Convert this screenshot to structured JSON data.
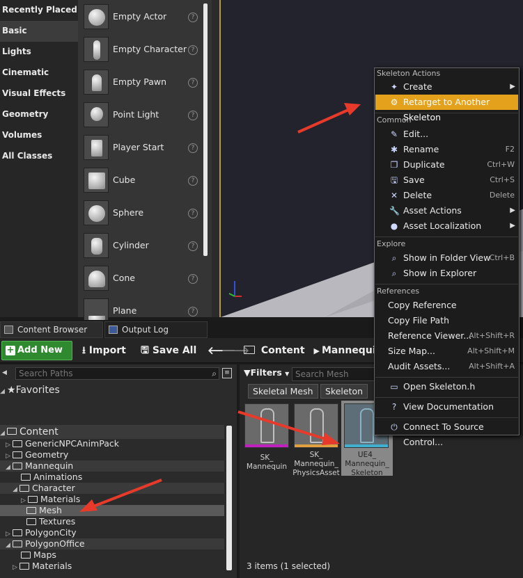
{
  "modes": {
    "categories": [
      "Recently Placed",
      "Basic",
      "Lights",
      "Cinematic",
      "Visual Effects",
      "Geometry",
      "Volumes",
      "All Classes"
    ],
    "selected_category": "Basic",
    "items": [
      "Empty Actor",
      "Empty Character",
      "Empty Pawn",
      "Point Light",
      "Player Start",
      "Cube",
      "Sphere",
      "Cylinder",
      "Cone",
      "Plane"
    ]
  },
  "tabs": {
    "content_browser": "Content Browser",
    "output_log": "Output Log"
  },
  "toolbar": {
    "add_new": "Add New",
    "import": "Import",
    "save_all": "Save All",
    "path_root": "Content",
    "path_child": "Mannequin"
  },
  "paths": {
    "search_placeholder": "Search Paths",
    "favorites": "Favorites",
    "tree": [
      "Content",
      "GenericNPCAnimPack",
      "Geometry",
      "Mannequin",
      "Animations",
      "Character",
      "Materials",
      "Mesh",
      "Textures",
      "PolygonCity",
      "PolygonOffice",
      "Maps",
      "Materials"
    ]
  },
  "assets": {
    "filters": "Filters",
    "search_placeholder": "Search Mesh",
    "chips": [
      "Skeletal Mesh",
      "Skeleton"
    ],
    "items": [
      {
        "label": "SK_\nMannequin",
        "stripe": "#c020c0"
      },
      {
        "label": "SK_\nMannequin_\nPhysicsAsset",
        "stripe": "#e0a040"
      },
      {
        "label": "UE4_\nMannequin_\nSkeleton",
        "stripe": "#40b0d0"
      }
    ],
    "status": "3 items (1 selected)"
  },
  "context_menu": {
    "sections": [
      "Skeleton Actions",
      "Common",
      "Explore",
      "References"
    ],
    "create": "Create",
    "retarget": "Retarget to Another Skeleton",
    "edit": "Edit...",
    "rename": "Rename",
    "rename_sc": "F2",
    "duplicate": "Duplicate",
    "duplicate_sc": "Ctrl+W",
    "save": "Save",
    "save_sc": "Ctrl+S",
    "delete": "Delete",
    "delete_sc": "Delete",
    "asset_actions": "Asset Actions",
    "asset_localization": "Asset Localization",
    "show_folder": "Show in Folder View",
    "show_folder_sc": "Ctrl+B",
    "show_explorer": "Show in Explorer",
    "copy_reference": "Copy Reference",
    "copy_file_path": "Copy File Path",
    "reference_viewer": "Reference Viewer...",
    "reference_viewer_sc": "Alt+Shift+R",
    "size_map": "Size Map...",
    "size_map_sc": "Alt+Shift+M",
    "audit_assets": "Audit Assets...",
    "audit_assets_sc": "Alt+Shift+A",
    "open_skeleton_h": "Open Skeleton.h",
    "view_docs": "View Documentation",
    "connect_source": "Connect To Source Control...",
    "highlight_color": "#e4a11b"
  }
}
